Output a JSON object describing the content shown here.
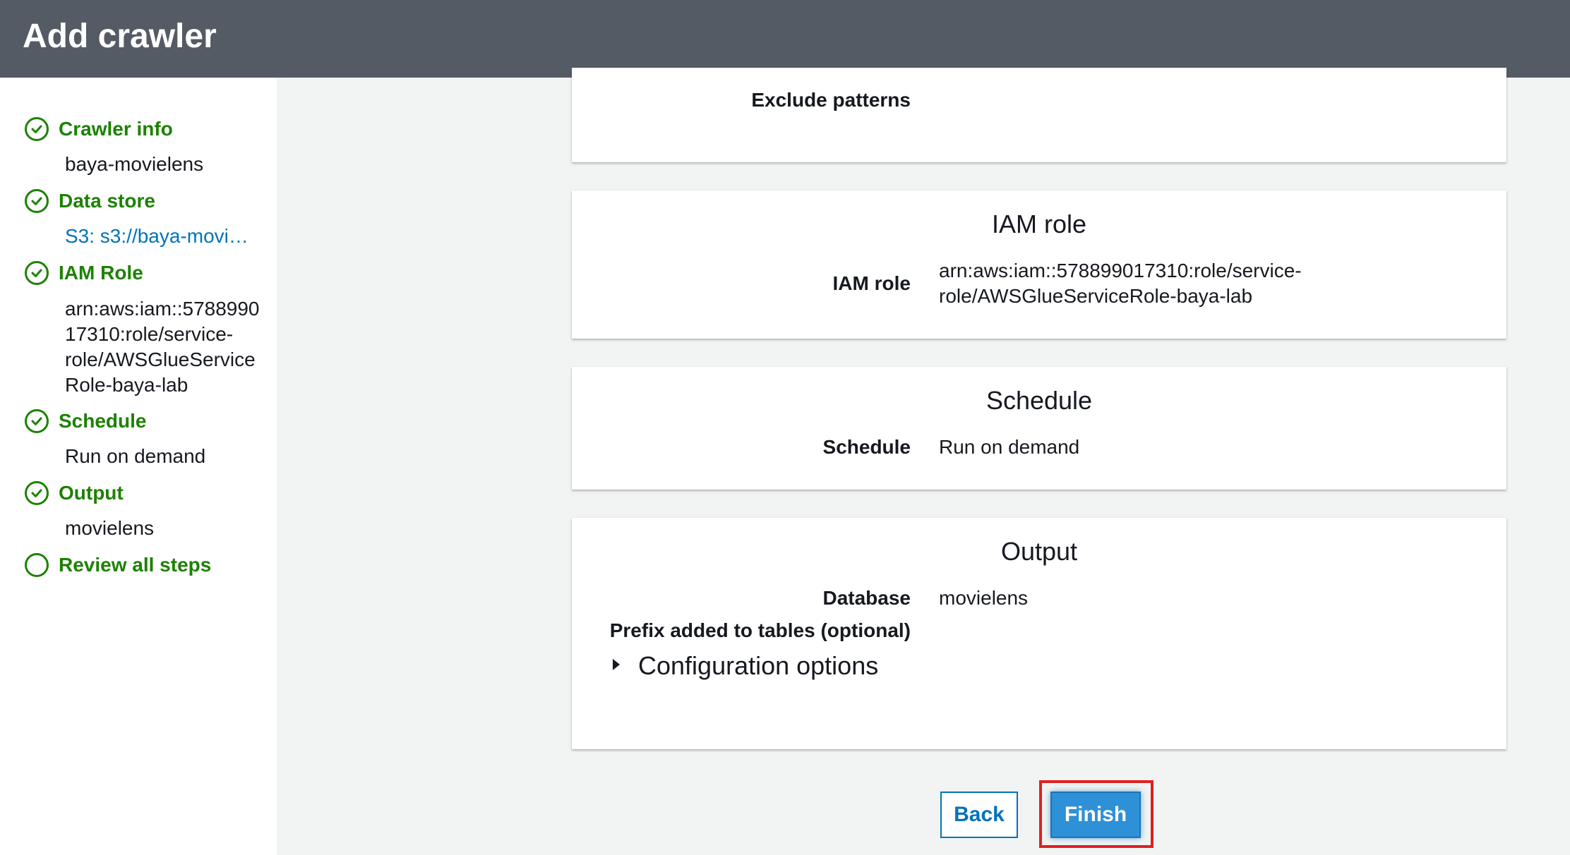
{
  "header": {
    "title": "Add crawler"
  },
  "sidebar": {
    "steps": [
      {
        "label": "Crawler info",
        "value": "baya-movielens",
        "status": "complete"
      },
      {
        "label": "Data store",
        "value": "S3: s3://baya-movi…",
        "status": "complete"
      },
      {
        "label": "IAM Role",
        "value": "arn:aws:iam::578899017310:role/service-role/AWSGlueServiceRole-baya-lab",
        "value_lines": [
          "arn:aws:iam::5788990",
          "17310:role/service-",
          "role/AWSGlueService",
          "Role-baya-lab"
        ],
        "status": "complete"
      },
      {
        "label": "Schedule",
        "value": "Run on demand",
        "status": "complete"
      },
      {
        "label": "Output",
        "value": "movielens",
        "status": "complete"
      },
      {
        "label": "Review all steps",
        "status": "current"
      }
    ]
  },
  "main": {
    "datastore_card": {
      "exclude_patterns_label": "Exclude patterns"
    },
    "iam_card": {
      "title": "IAM role",
      "label": "IAM role",
      "value_line1": "arn:aws:iam::578899017310:role/service-",
      "value_line2": "role/AWSGlueServiceRole-baya-lab"
    },
    "schedule_card": {
      "title": "Schedule",
      "label": "Schedule",
      "value": "Run on demand"
    },
    "output_card": {
      "title": "Output",
      "database_label": "Database",
      "database_value": "movielens",
      "prefix_label": "Prefix added to tables (optional)",
      "config_label": "Configuration options"
    }
  },
  "footer": {
    "back_label": "Back",
    "finish_label": "Finish"
  },
  "colors": {
    "header_bg": "#545b64",
    "step_green": "#1d8102",
    "link_blue": "#0073bb",
    "primary_button": "#2e90d6",
    "highlight_red": "#e02020"
  }
}
